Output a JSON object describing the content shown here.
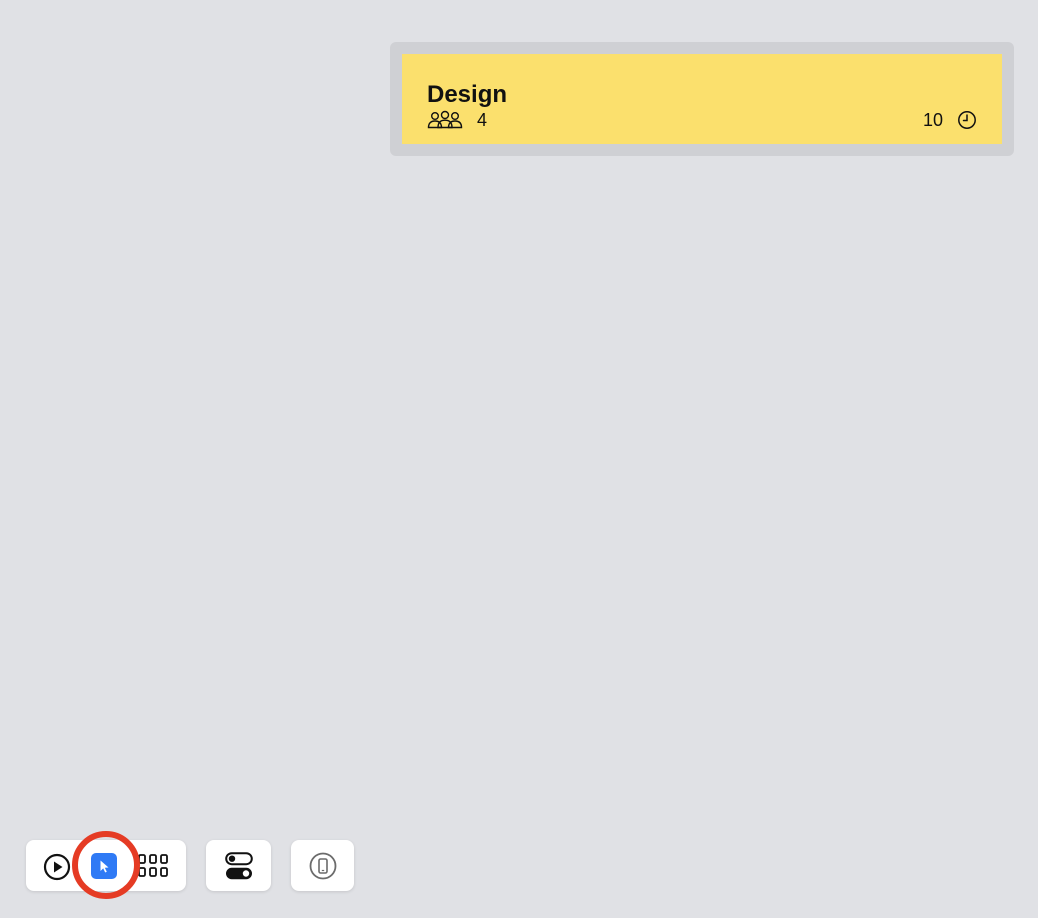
{
  "card": {
    "title": "Design",
    "people_count": "4",
    "duration": "10",
    "icons": {
      "people": "people-group-icon",
      "clock": "clock-icon"
    },
    "background_color": "#fbe06d"
  },
  "toolbar": {
    "buttons": [
      {
        "name": "play-button",
        "icon": "play-icon"
      },
      {
        "name": "select-mode-button",
        "icon": "cursor-arrow-icon",
        "active": true
      },
      {
        "name": "grid-view-button",
        "icon": "grid-icon"
      },
      {
        "name": "toggles-button",
        "icon": "toggles-icon"
      },
      {
        "name": "device-preview-button",
        "icon": "phone-icon"
      }
    ],
    "accent_color": "#2f7af5"
  },
  "annotation": {
    "highlight_color": "#e53b24"
  }
}
